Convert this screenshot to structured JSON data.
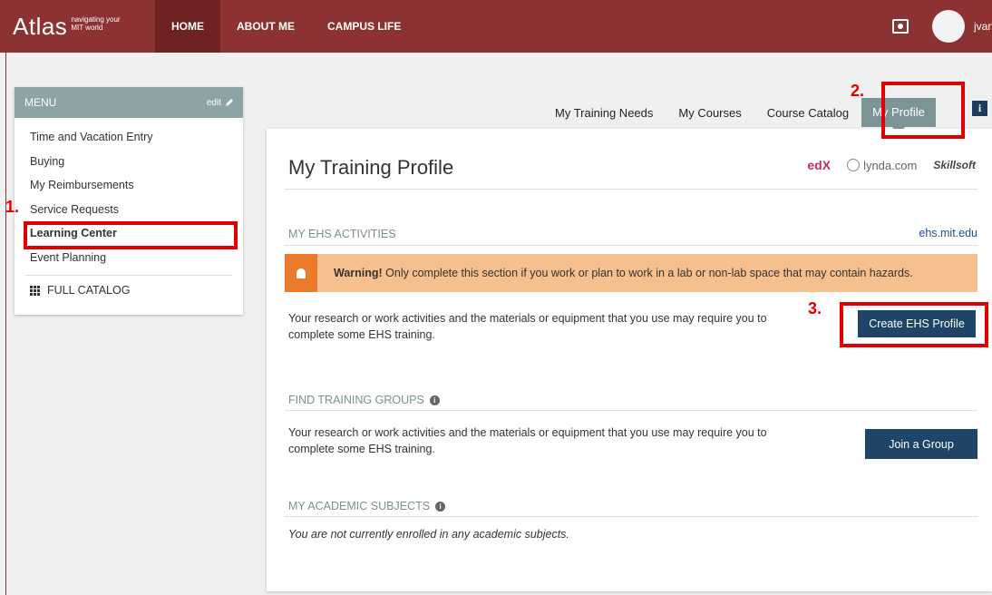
{
  "topbar": {
    "logo": "Atlas",
    "tagline_line1": "navigating your",
    "tagline_line2": "MIT world",
    "nav": [
      "HOME",
      "ABOUT ME",
      "CAMPUS LIFE"
    ],
    "username": "jvan"
  },
  "menu": {
    "title": "MENU",
    "edit_label": "edit",
    "items": [
      "Time and Vacation Entry",
      "Buying",
      "My Reimbursements",
      "Service Requests",
      "Learning Center",
      "Event Planning"
    ],
    "full_catalog": "FULL CATALOG"
  },
  "tabs": [
    "My Training Needs",
    "My Courses",
    "Course Catalog",
    "My Profile"
  ],
  "annotations": [
    "1.",
    "2.",
    "3."
  ],
  "main": {
    "title": "My Training Profile",
    "providers": [
      "edX",
      "lynda.com",
      "Skillsoft"
    ],
    "ehs": {
      "heading": "MY EHS ACTIVITIES",
      "link": "ehs.mit.edu",
      "warning_bold": "Warning!",
      "warning_text": " Only complete this section if you work or plan to work in a lab or non-lab space that may contain hazards.",
      "description": "Your research or work activities and the materials or equipment that you use may require you to complete some EHS training.",
      "button": "Create EHS Profile"
    },
    "groups": {
      "heading": "FIND TRAINING GROUPS",
      "description": "Your research or work activities and the materials or equipment that you use may require you to complete some EHS training.",
      "button": "Join a Group"
    },
    "subjects": {
      "heading": "MY ACADEMIC SUBJECTS",
      "empty_text": "You are not currently enrolled in any academic subjects."
    }
  },
  "colors": {
    "topbar": "#8c3232",
    "menu_header": "#8da3a6",
    "button": "#1e4468",
    "warning_bg": "#f5c08e",
    "warning_icon": "#ec7a2b",
    "annotation": "#e00000"
  }
}
